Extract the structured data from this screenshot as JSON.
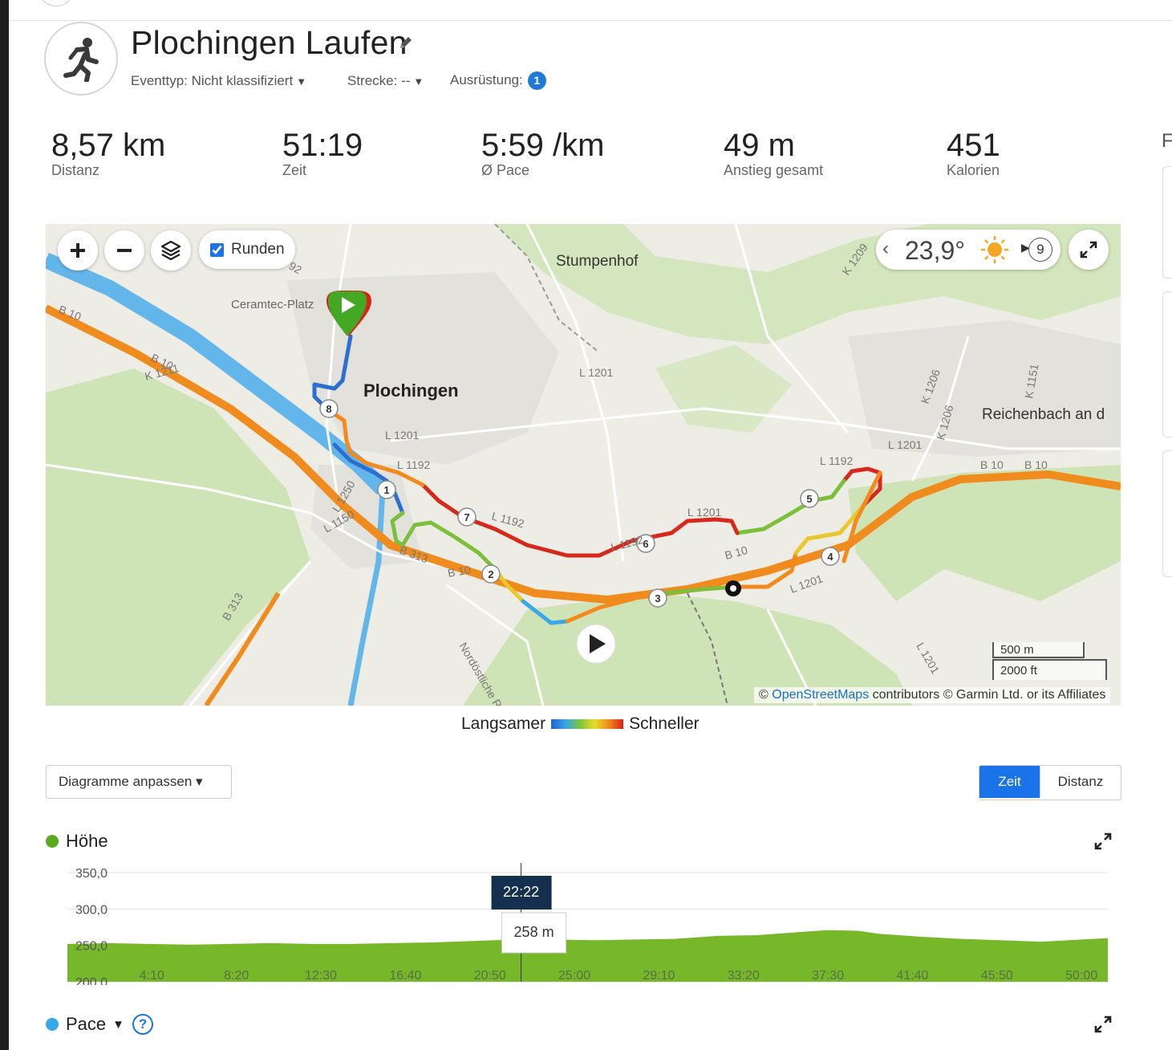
{
  "activity": {
    "title": "Plochingen Laufen",
    "event_type_label": "Eventtyp:",
    "event_type_value": "Nicht klassifiziert",
    "course_label": "Strecke:",
    "course_value": "--",
    "gear_label": "Ausrüstung:",
    "gear_count": "1"
  },
  "stats": [
    {
      "value": "8,57 km",
      "label": "Distanz"
    },
    {
      "value": "51:19",
      "label": "Zeit"
    },
    {
      "value": "5:59 /km",
      "label": "Ø Pace"
    },
    {
      "value": "49 m",
      "label": "Anstieg gesamt"
    },
    {
      "value": "451",
      "label": "Kalorien"
    }
  ],
  "side_panel_letter": "F",
  "map": {
    "laps_checkbox_label": "Runden",
    "laps_checked": true,
    "temperature": "23,9°",
    "wind_speed": "9",
    "place_labels": [
      "Stumpenhof",
      "Ceramtec-Platz",
      "Plochingen",
      "Reichenbach an d"
    ],
    "road_labels": [
      "B 10",
      "B 10",
      "K 1211",
      "L 1201",
      "L 1201",
      "L 1192",
      "L 1192",
      "L 1192",
      "L 1201",
      "L 1201",
      "L 1192",
      "B 313",
      "B 313",
      "K 1206",
      "K 1151",
      "K 1206",
      "L 1201",
      "L 1150",
      "L 1250",
      "K 1209",
      "B 10",
      "B 10",
      "B 10",
      "B 10",
      "Nordöstliche Ra",
      "L 1201",
      "92"
    ],
    "lap_markers": [
      "1",
      "2",
      "3",
      "4",
      "5",
      "6",
      "7",
      "8"
    ],
    "scale_metric": "500 m",
    "scale_imperial": "2000 ft",
    "attribution_prefix": "©",
    "attribution_link": "OpenStreetMaps",
    "attribution_suffix": "contributors © Garmin Ltd. or its Affiliates"
  },
  "speed_legend": {
    "slow": "Langsamer",
    "fast": "Schneller"
  },
  "controls": {
    "customize_charts": "Diagramme anpassen",
    "toggle_time": "Zeit",
    "toggle_distance": "Distanz"
  },
  "colors": {
    "accent": "#1a73e8",
    "elevation_green": "#76b82a",
    "pace_blue": "#38a8e6",
    "route_orange": "#f28a1d",
    "start_green": "#43a823"
  },
  "elevation_section": {
    "title": "Höhe"
  },
  "pace_section": {
    "title": "Pace"
  },
  "chart_data": {
    "type": "area",
    "title": "Höhe",
    "xlabel": "",
    "ylabel": "",
    "y_ticks": [
      "350,0",
      "300,0",
      "250,0",
      "200,0"
    ],
    "ylim": [
      200,
      350
    ],
    "x_ticks": [
      "4:10",
      "8:20",
      "12:30",
      "16:40",
      "20:50",
      "25:00",
      "29:10",
      "33:20",
      "37:30",
      "41:40",
      "45:50",
      "50:00"
    ],
    "x_minutes": [
      0,
      2,
      4,
      6,
      8,
      10,
      12,
      14,
      16,
      18,
      20,
      22,
      24,
      26,
      28,
      30,
      32,
      34,
      36,
      37.5,
      39,
      40,
      42,
      44,
      46,
      48,
      50,
      51.3
    ],
    "y_values": [
      252,
      253,
      252,
      251,
      252,
      253,
      252,
      252,
      253,
      254,
      256,
      258,
      258,
      257,
      258,
      259,
      263,
      264,
      268,
      271,
      270,
      266,
      262,
      259,
      257,
      255,
      258,
      260
    ],
    "cursor": {
      "time": "22:22",
      "value": "258 m",
      "x_minutes": 22.37
    }
  }
}
